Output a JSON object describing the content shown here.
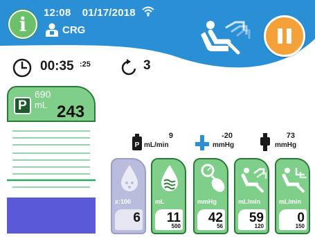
{
  "header": {
    "time": "12:08",
    "date": "01/17/2018",
    "user_name": "CRG",
    "brand_color": "#2b8fd6",
    "icons": {
      "info": "info-icon",
      "wifi": "wifi-icon",
      "user": "user-icon",
      "reclined_patient": "reclined-patient-icon",
      "pause": "pause-icon"
    },
    "info_label": "i"
  },
  "status": {
    "elapsed": "00:35",
    "elapsed_seconds": ":25",
    "cycle_count": "3",
    "icons": {
      "clock": "clock-icon",
      "cycle": "cycle-icon"
    }
  },
  "plasma": {
    "badge": "P",
    "target": "690",
    "unit": "mL",
    "value": "243",
    "fill_color": "#5a5ad6"
  },
  "readouts": [
    {
      "icon": "plasma-bag-icon",
      "value": "9",
      "unit": "mL/min"
    },
    {
      "icon": "access-pressure-icon",
      "value": "-20",
      "unit": "mmHg"
    },
    {
      "icon": "return-pressure-icon",
      "value": "73",
      "unit": "mmHg"
    }
  ],
  "pumps": [
    {
      "icon": "anticoagulant-drop-icon",
      "unit": "x:100",
      "value": "6",
      "limit": "",
      "enabled": false
    },
    {
      "icon": "saline-drop-icon",
      "unit": "mL",
      "value": "11",
      "limit": "500",
      "enabled": true
    },
    {
      "icon": "pressure-gauge-icon",
      "unit": "mmHg",
      "value": "42",
      "limit": "56",
      "enabled": true
    },
    {
      "icon": "draw-flow-icon",
      "unit": "mL/min",
      "value": "59",
      "limit": "120",
      "enabled": true
    },
    {
      "icon": "return-flow-icon",
      "unit": "mL/min",
      "value": "0",
      "limit": "150",
      "enabled": true
    }
  ]
}
